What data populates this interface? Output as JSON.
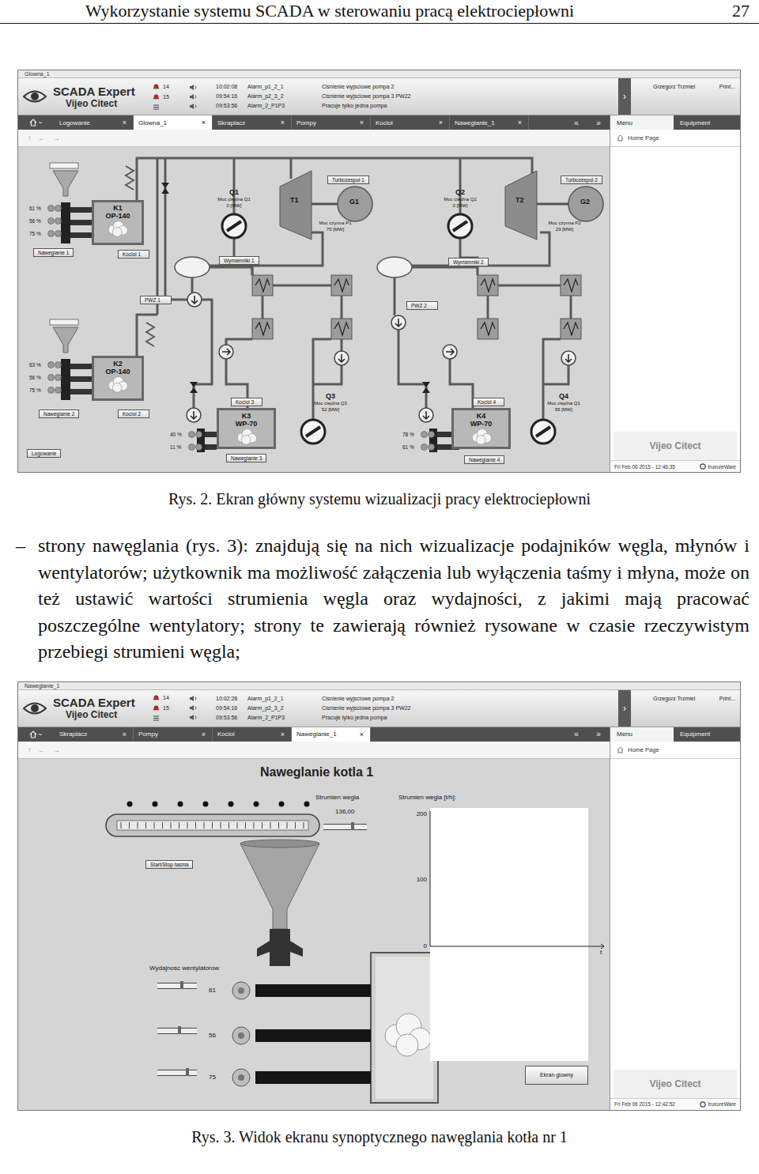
{
  "running_head": {
    "title": "Wykorzystanie systemu SCADA w sterowaniu pracą elektrociepłowni",
    "page_number": "27"
  },
  "figure_main": {
    "window": {
      "title": "Glowna_1",
      "logo_top": "SCADA Expert",
      "logo_bottom": "Vijeo Citect",
      "alarm_counts": [
        "14",
        "15"
      ],
      "alarms": [
        {
          "time": "10:02:08",
          "tag": "Alarm_p1_2_1",
          "message": "Cisnienie wyjsciowe pompa 2"
        },
        {
          "time": "09:54:16",
          "tag": "Alarm_p2_3_2",
          "message": "Cisnienie wyjsciowe pompa 3 PW22"
        },
        {
          "time": "09:53:56",
          "tag": "Alarm_2_P1P3",
          "message": "Pracuje tylko jedna pompa"
        }
      ],
      "expand": "›",
      "user": "Grzegorz Trzmiel",
      "print": "Print..."
    },
    "tabs": [
      {
        "label": "Logowanie",
        "close": "×",
        "selected": false
      },
      {
        "label": "Glowna_1",
        "close": "×",
        "selected": true
      },
      {
        "label": "Skraplacz",
        "close": "×",
        "selected": false
      },
      {
        "label": "Pompy",
        "close": "×",
        "selected": false
      },
      {
        "label": "Kociol",
        "close": "×",
        "selected": false
      },
      {
        "label": "Naweglanie_1",
        "close": "×",
        "selected": false
      }
    ],
    "tab_arrows": [
      "«",
      "»"
    ],
    "side_tabs": [
      {
        "label": "Menu",
        "selected": true
      },
      {
        "label": "Equipment",
        "selected": false
      }
    ],
    "toolbar": [
      "↑",
      "←",
      "→"
    ],
    "side": {
      "home": "Home Page",
      "watermark": "Vijeo Citect"
    },
    "status": {
      "date": "Fri Feb 06 2015 - 12:46:35",
      "brand": "truxureWare"
    },
    "diagram": {
      "boilers": [
        {
          "name": "K1",
          "type": "OP-140",
          "feeds": [
            "61 %",
            "56 %",
            "75 %"
          ],
          "coal_button": "Naweglanie 1",
          "boiler_button": "Kociol 1"
        },
        {
          "name": "K2",
          "type": "OP-140",
          "feeds": [
            "63 %",
            "56 %",
            "75 %"
          ],
          "coal_button": "Naweglanie 2",
          "boiler_button": "Kociol 2"
        },
        {
          "name": "K3",
          "type": "WP-70",
          "feeds": [
            "40 %",
            "11 %"
          ],
          "coal_button": "Naweglanie 3",
          "boiler_button": "Kociol 3"
        },
        {
          "name": "K4",
          "type": "WP-70",
          "feeds": [
            "78 %",
            "61 %"
          ],
          "coal_button": "Naweglanie 4",
          "boiler_button": "Kociol 4"
        }
      ],
      "heat_outputs": [
        {
          "name": "Q1",
          "label": "Moc cieplna Q1",
          "value": "0 [MW]"
        },
        {
          "name": "Q2",
          "label": "Moc cieplna Q2",
          "value": "0 [MW]"
        },
        {
          "name": "Q3",
          "label": "Moc cieplna Q3",
          "value": "52 [MW]"
        },
        {
          "name": "Q4",
          "label": "Moc cieplna Q1",
          "value": "95 [MW]"
        }
      ],
      "turbosets": [
        {
          "turbine": "T1",
          "generator": "G1",
          "button": "Turbozespol 1",
          "label": "Moc czynna P1",
          "value": "75 [MW]"
        },
        {
          "turbine": "T2",
          "generator": "G2",
          "button": "Turbozespol 2",
          "label": "Moc czynna P2",
          "value": "29 [MW]"
        }
      ],
      "exchangers": [
        "Wymienniki 1",
        "Wymienniki 2"
      ],
      "pwz": [
        "PWZ 1",
        "PWZ 2"
      ],
      "login": "Logowanie"
    }
  },
  "caption_main": "Rys. 2. Ekran główny systemu wizualizacji pracy elektrociepłowni",
  "paragraph": {
    "bullet": "–",
    "text": "strony nawęglania (rys. 3): znajdują się na nich wizualizacje podajników węgla, młynów i wentylatorów; użytkownik ma możliwość załączenia lub wyłączenia taśmy i młyna, może on też ustawić wartości strumienia węgla oraz wydajności, z jakimi mają pracować poszczególne wentylatory; strony te zawierają również rysowane w czasie rzeczywistym przebiegi strumieni węgla;"
  },
  "figure_coal": {
    "window": {
      "title": "Naweglanie_1",
      "logo_top": "SCADA Expert",
      "logo_bottom": "Vijeo Citect",
      "alarm_counts": [
        "14",
        "15"
      ],
      "alarms": [
        {
          "time": "10:02:28",
          "tag": "Alarm_p1_2_1",
          "message": "Cisnienie wyjsciowe pompa 2"
        },
        {
          "time": "09:54:16",
          "tag": "Alarm_p2_3_2",
          "message": "Cisnienie wyjsciowe pompa 3 PW22"
        },
        {
          "time": "09:53:56",
          "tag": "Alarm_2_P1P3",
          "message": "Pracuje tylko jedna pompa"
        }
      ],
      "expand": "›",
      "user": "Grzegorz Trzmiel",
      "print": "Print..."
    },
    "tabs": [
      {
        "label": "Skraplacz",
        "close": "×",
        "selected": false
      },
      {
        "label": "Pompy",
        "close": "×",
        "selected": false
      },
      {
        "label": "Kociol",
        "close": "×",
        "selected": false
      },
      {
        "label": "Naweglanie_1",
        "close": "×",
        "selected": true
      }
    ],
    "tab_arrows": [
      "«",
      "»"
    ],
    "side_tabs": [
      {
        "label": "Menu",
        "selected": true
      },
      {
        "label": "Equipment",
        "selected": false
      }
    ],
    "toolbar": [
      "↑",
      "←",
      "→"
    ],
    "side": {
      "home": "Home Page",
      "watermark": "Vijeo Citect"
    },
    "status": {
      "date": "Fri Feb 06 2015 - 12:42:52",
      "brand": "truxureWare"
    },
    "screen": {
      "title": "Naweglanie kotla 1",
      "belt_button": "Start/Stop tasma",
      "flow": {
        "label": "Strumien wegla",
        "value": "136,00",
        "level": 0.68
      },
      "chart": {
        "title": "Strumien wegla [t/h]:",
        "ticks": [
          "200",
          "100",
          "0"
        ],
        "time_label": "t",
        "series": [
          {
            "values": []
          }
        ]
      },
      "fans": {
        "title": "Wydajnosc wentylatorow",
        "items": [
          {
            "value": "61",
            "level": 0.61
          },
          {
            "value": "56",
            "level": 0.56
          },
          {
            "value": "75",
            "level": 0.75
          }
        ]
      },
      "back_button": "Ekran glowny"
    }
  },
  "caption_coal": "Rys. 3. Widok ekranu synoptycznego nawęglania kotła nr 1"
}
